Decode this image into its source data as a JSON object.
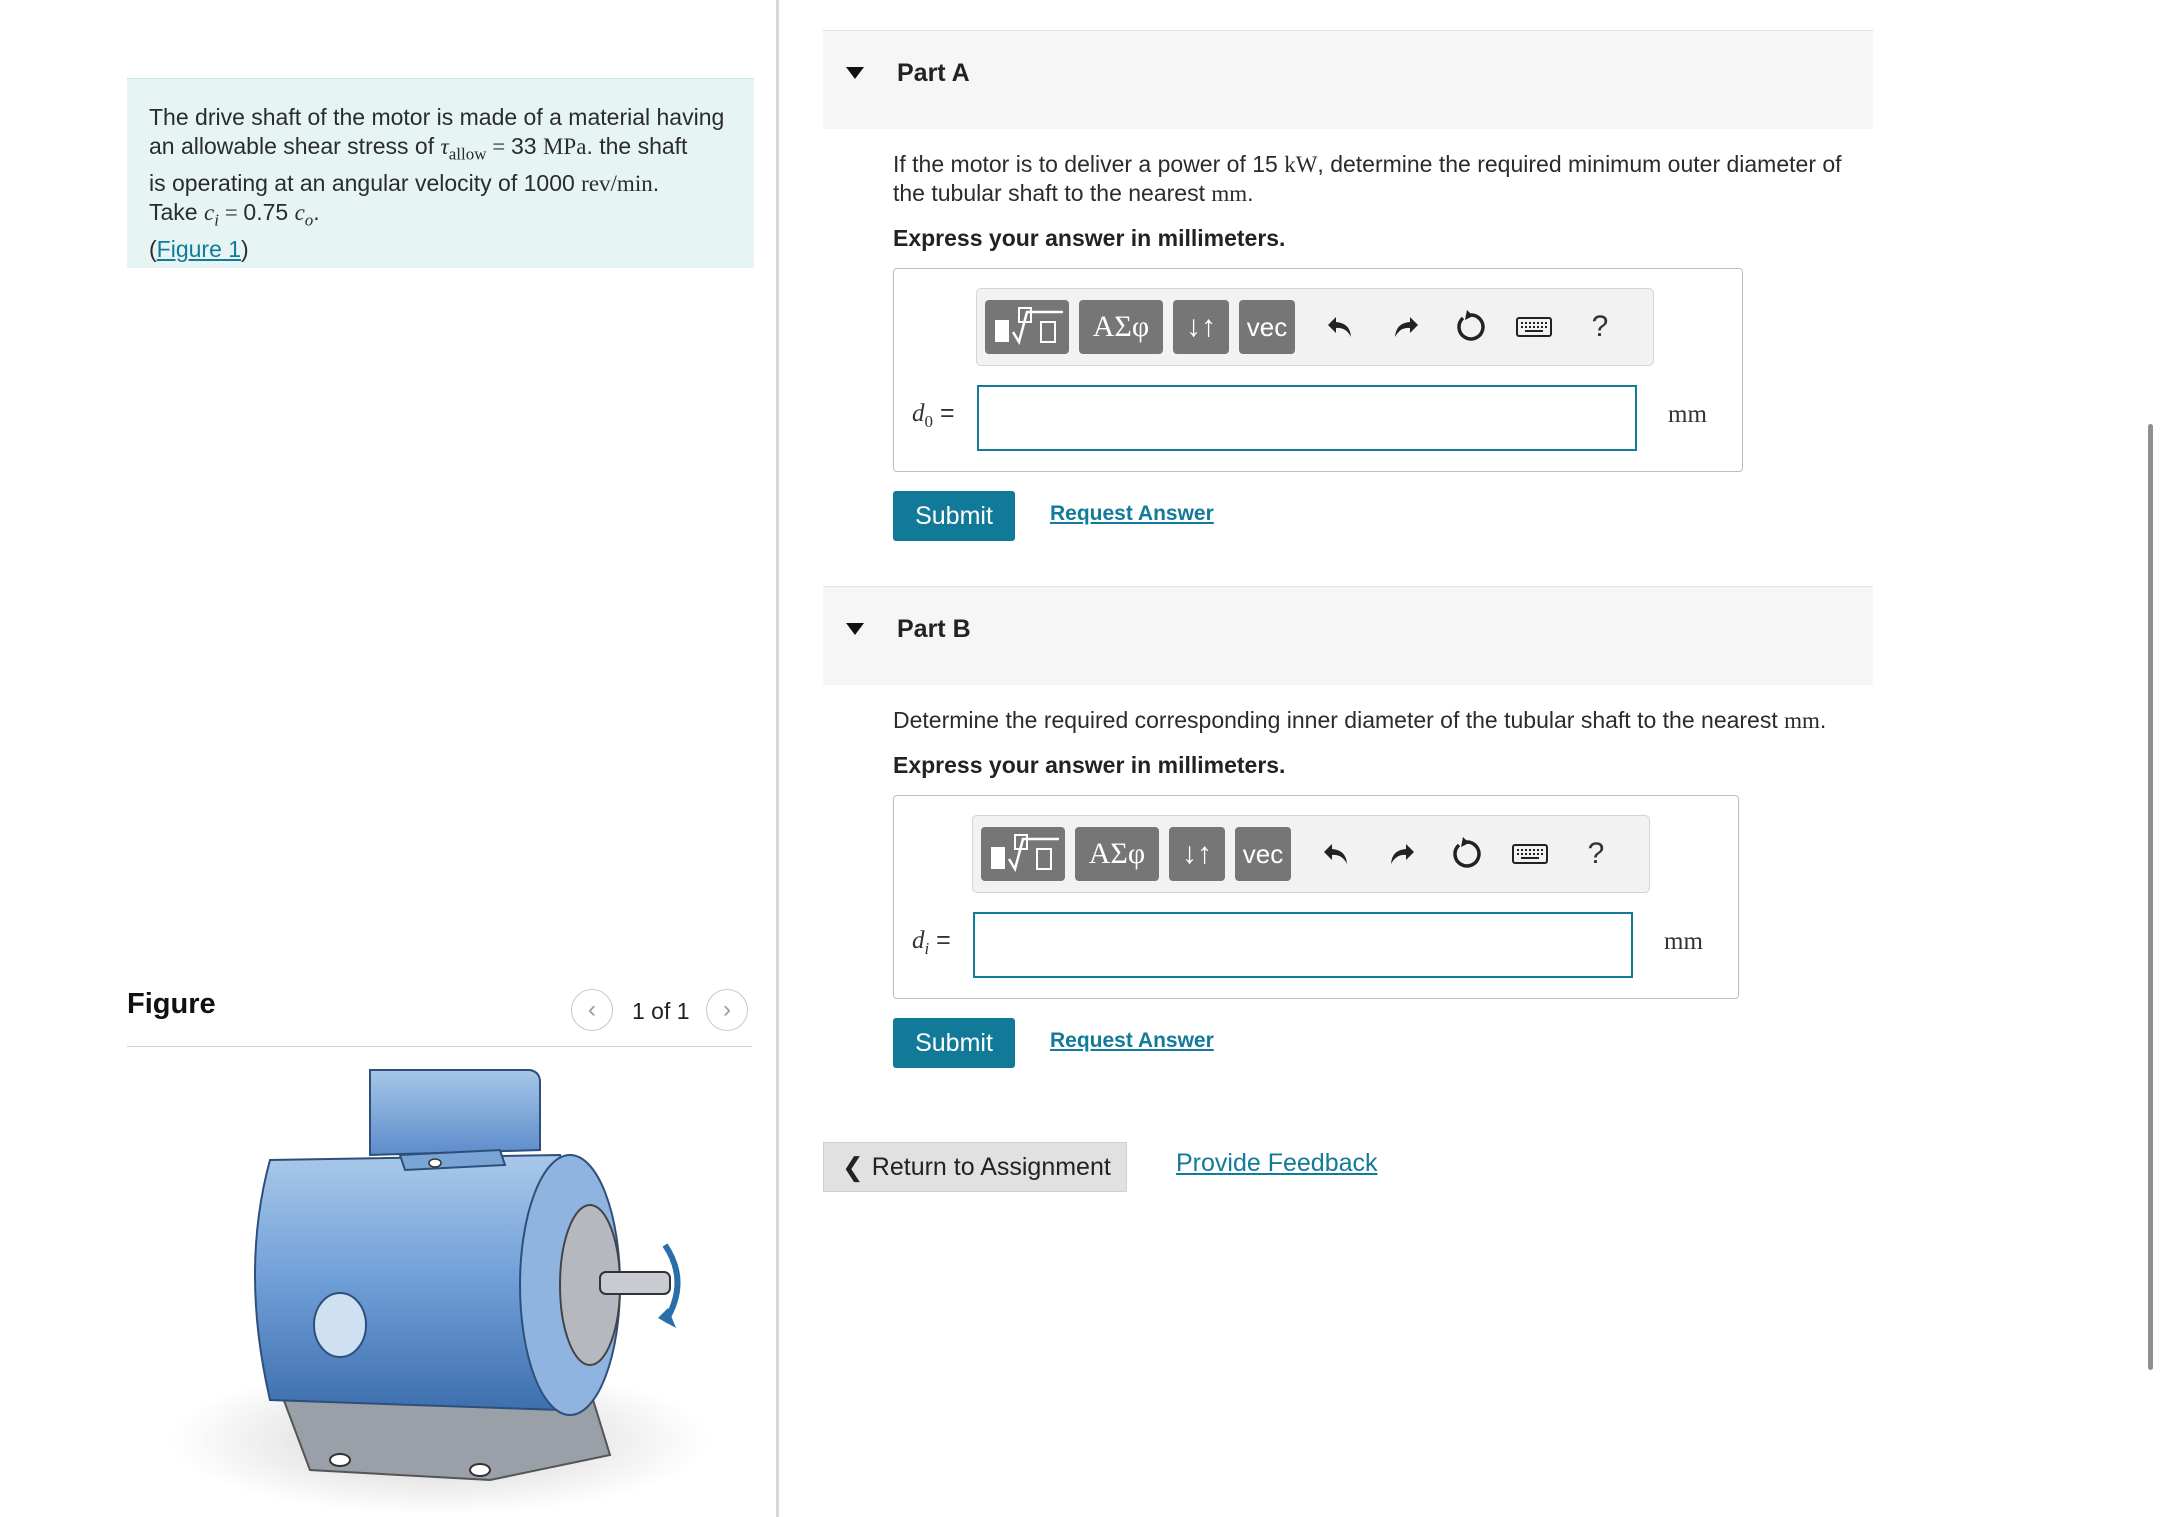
{
  "problem": {
    "line1": "The drive shaft of the motor is made of a material having",
    "line2_pre": "an allowable shear stress of ",
    "tau_symbol": "τ",
    "tau_subscript": "allow",
    "line2_eq": " = ",
    "line2_val": "33 ",
    "line2_unit": "MPa",
    "line2_post": ". the shaft",
    "line3_pre": "is operating at an angular velocity of 1000 ",
    "line3_unit": "rev/min",
    "line3_post": ".",
    "line4_pre": "Take ",
    "ci_symbol": "c",
    "ci_sub": "i",
    "line4_eq": " = ",
    "line4_val": "0.75 ",
    "co_symbol": "c",
    "co_sub": "o",
    "line4_post": ".",
    "figure_link_open": "(",
    "figure_link": "Figure 1",
    "figure_link_close": ")"
  },
  "figure": {
    "title": "Figure",
    "pager_text": "1 of 1",
    "prev_glyph": "‹",
    "next_glyph": "›"
  },
  "parts": [
    {
      "title": "Part A",
      "question_pre": "If the motor is to deliver a power of 15 ",
      "question_unit1": "kW",
      "question_mid": ", determine the required minimum outer diameter of",
      "question_line2_pre": "the tubular shaft to the nearest ",
      "question_unit2": "mm",
      "question_line2_post": ".",
      "instruction": "Express your answer in millimeters.",
      "var_symbol": "d",
      "var_sub": "0",
      "var_eq": " =",
      "input_value": "",
      "unit": "mm",
      "submit": "Submit",
      "request": "Request Answer"
    },
    {
      "title": "Part B",
      "question_pre": "Determine the required corresponding inner diameter of the tubular shaft to the nearest ",
      "question_unit": "mm",
      "question_post": ".",
      "instruction": "Express your answer in millimeters.",
      "var_symbol": "d",
      "var_sub": "i",
      "var_eq": " =",
      "input_value": "",
      "unit": "mm",
      "submit": "Submit",
      "request": "Request Answer"
    }
  ],
  "toolbar": {
    "greek": "ΑΣφ",
    "arrows": "↓↑",
    "vec": "vec",
    "help": "?"
  },
  "footer": {
    "return_chevron": "❮",
    "return_label": "Return to Assignment",
    "feedback": "Provide Feedback"
  },
  "colors": {
    "accent": "#117a99",
    "problem_bg": "#e6f5f4",
    "toolbar_btn": "#767676"
  }
}
